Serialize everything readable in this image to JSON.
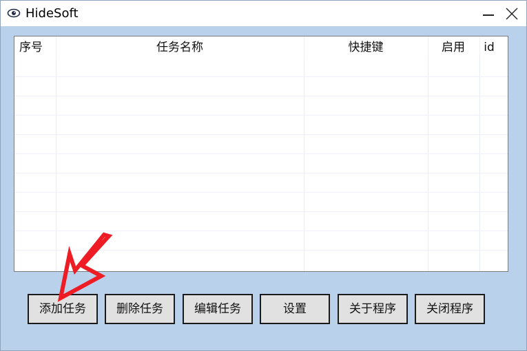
{
  "window": {
    "title": "HideSoft",
    "icon": "eye-icon"
  },
  "table": {
    "columns": [
      "序号",
      "任务名称",
      "快捷键",
      "启用",
      "id"
    ],
    "rows": []
  },
  "buttons": {
    "add": "添加任务",
    "delete": "删除任务",
    "edit": "编辑任务",
    "settings": "设置",
    "about": "关于程序",
    "close": "关闭程序"
  },
  "colors": {
    "background": "#b9d1ea",
    "annotation_arrow": "#ee1c24"
  }
}
